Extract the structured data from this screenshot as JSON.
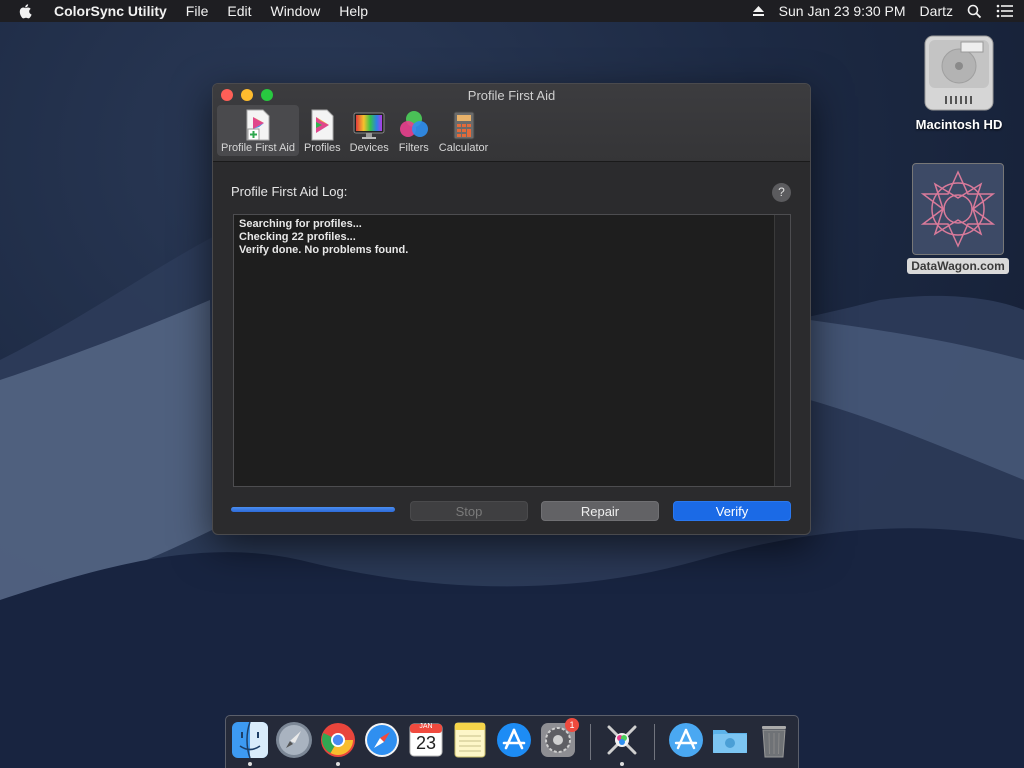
{
  "menubar": {
    "app_name": "ColorSync Utility",
    "menus": [
      "File",
      "Edit",
      "Window",
      "Help"
    ],
    "clock": "Sun Jan 23  9:30 PM",
    "user": "Dartz"
  },
  "window": {
    "title": "Profile First Aid",
    "toolbar": [
      {
        "label": "Profile First Aid",
        "icon": "profile-first-aid-icon",
        "active": true
      },
      {
        "label": "Profiles",
        "icon": "profiles-icon"
      },
      {
        "label": "Devices",
        "icon": "devices-icon"
      },
      {
        "label": "Filters",
        "icon": "filters-icon"
      },
      {
        "label": "Calculator",
        "icon": "calculator-icon"
      }
    ],
    "log_label": "Profile First Aid Log:",
    "help": "?",
    "log_lines": [
      "Searching for profiles...",
      "Checking 22 profiles...",
      "Verify done. No problems found."
    ],
    "progress_fraction": 1.0,
    "buttons": {
      "stop": "Stop",
      "repair": "Repair",
      "verify": "Verify"
    }
  },
  "desktop": {
    "icons": [
      {
        "label": "Macintosh HD",
        "icon": "hard-drive-icon"
      },
      {
        "label": "DataWagon.com",
        "icon": "image-file-icon"
      }
    ]
  },
  "dock": {
    "apps": [
      "finder-icon",
      "launchpad-icon",
      "chrome-icon",
      "safari-icon",
      "calendar-icon",
      "notes-icon",
      "app-store-icon",
      "system-preferences-icon",
      "colorsync-utility-icon",
      "applications-folder-icon",
      "downloads-folder-icon",
      "trash-icon"
    ],
    "calendar_month": "JAN",
    "calendar_day": "23",
    "prefs_badge": "1"
  },
  "colors": {
    "accent": "#1b6ae6",
    "window_bg": "#2b2b2d"
  }
}
